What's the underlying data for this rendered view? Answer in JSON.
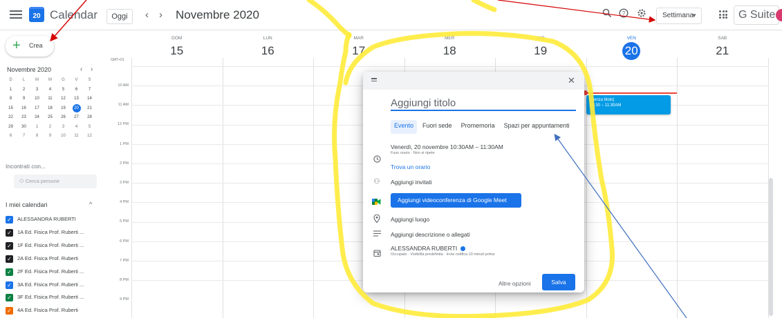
{
  "header": {
    "app_title": "Calendar",
    "logo_day": "20",
    "today_label": "Oggi",
    "prev_icon": "chevron-left-icon",
    "next_icon": "chevron-right-icon",
    "date_range": "Novembre 2020",
    "view_label": "Settimana",
    "brand": "G Suite"
  },
  "sidebar": {
    "create_label": "Crea",
    "mini_month": "Novembre 2020",
    "weekday_heads": [
      "D",
      "L",
      "M",
      "M",
      "G",
      "V",
      "S"
    ],
    "weeks": [
      [
        "1",
        "2",
        "3",
        "4",
        "5",
        "6",
        "7"
      ],
      [
        "8",
        "9",
        "10",
        "11",
        "12",
        "13",
        "14"
      ],
      [
        "15",
        "16",
        "17",
        "18",
        "19",
        "20",
        "21"
      ],
      [
        "22",
        "23",
        "24",
        "25",
        "26",
        "27",
        "28"
      ],
      [
        "29",
        "30",
        "1",
        "2",
        "3",
        "4",
        "5"
      ],
      [
        "6",
        "7",
        "8",
        "9",
        "10",
        "11",
        "12"
      ]
    ],
    "selected_day": "20",
    "meet_label": "Incontrati con...",
    "people_placeholder": "Cerca persone",
    "my_calendars_label": "I miei calendari",
    "calendars": [
      {
        "name": "ALESSANDRA RUBERTI",
        "color": "#1a73e8"
      },
      {
        "name": "1A Ed. Fisica Prof. Ruberti ...",
        "color": "#202124"
      },
      {
        "name": "1F Ed. Fisica Prof. Ruberti ...",
        "color": "#202124"
      },
      {
        "name": "2A Ed. Fisica Prof. Ruberti",
        "color": "#202124"
      },
      {
        "name": "2F Ed. Fisica Prof. Ruberti ...",
        "color": "#0b8043"
      },
      {
        "name": "3A Ed. Fisica Prof. Ruberti ...",
        "color": "#1a73e8"
      },
      {
        "name": "3F Ed. Fisica Prof. Ruberti ...",
        "color": "#0b8043"
      },
      {
        "name": "4A Ed. Fisica Prof. Ruberti",
        "color": "#ef6c00"
      }
    ]
  },
  "week": {
    "timezone": "GMT+01",
    "days": [
      {
        "name": "DOM",
        "date": "15"
      },
      {
        "name": "LUN",
        "date": "16"
      },
      {
        "name": "MAR",
        "date": "17"
      },
      {
        "name": "MER",
        "date": "18"
      },
      {
        "name": "GIO",
        "date": "19"
      },
      {
        "name": "VEN",
        "date": "20",
        "today": true
      },
      {
        "name": "SAB",
        "date": "21"
      }
    ],
    "hours": [
      "10 AM",
      "11 AM",
      "12 PM",
      "1 PM",
      "2 PM",
      "3 PM",
      "4 PM",
      "5 PM",
      "6 PM",
      "7 PM",
      "8 PM",
      "9 PM"
    ],
    "event": {
      "title": "(Senza titolo)",
      "time": "10:30 – 11:30AM"
    }
  },
  "dialog": {
    "close_icon": "close-icon",
    "title_placeholder": "Aggiungi titolo",
    "tabs": [
      "Evento",
      "Fuori sede",
      "Promemoria",
      "Spazi per appuntamenti"
    ],
    "active_tab": "Evento",
    "datetime": "Venerdì, 20 novembre   10:30AM  –  11:30AM",
    "datetime_sub": "Fuso orario · Non si ripete",
    "find_time": "Trova un orario",
    "guests": "Aggiungi invitati",
    "meet_button": "Aggiungi videoconferenza di Google Meet",
    "location": "Aggiungi luogo",
    "description": "Aggiungi descrizione o allegati",
    "owner": "ALESSANDRA RUBERTI",
    "owner_sub": "Occupato · Visibilità predefinita · Invia notifica 10 minuti prima",
    "more_options": "Altre opzioni",
    "save": "Salva"
  },
  "annotations": {
    "highlight_color": "#ffeb3b",
    "arrow_color_red": "#d50000",
    "arrow_color_blue": "#3f6fbf"
  }
}
